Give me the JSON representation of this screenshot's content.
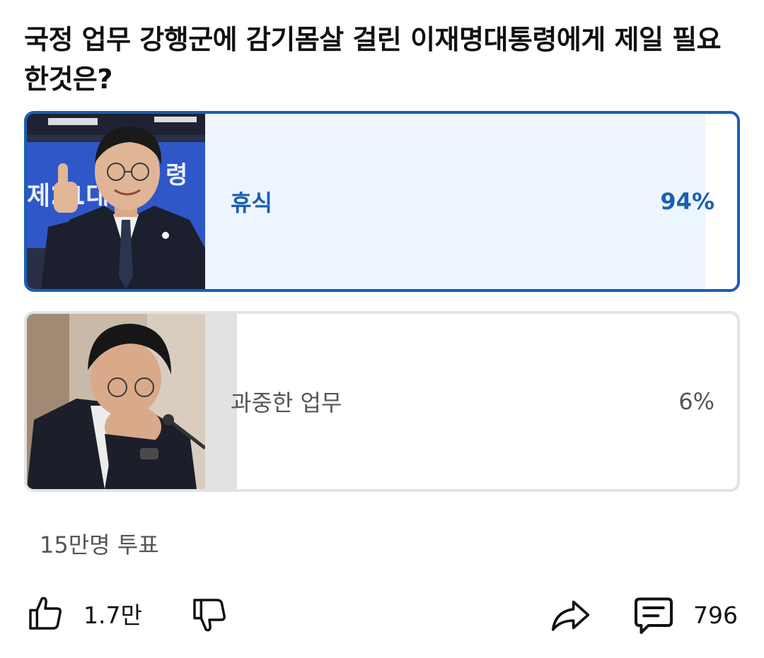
{
  "poll": {
    "question": "국정 업무 강행군에 감기몸살 걸린 이재명대통령에게 제일 필요한것은?",
    "options": [
      {
        "label": "휴식",
        "percent": "94%",
        "fraction": 0.94,
        "selected": true
      },
      {
        "label": "과중한 업무",
        "percent": "6%",
        "fraction": 0.06,
        "selected": false
      }
    ],
    "total_votes": "15만명 투표"
  },
  "actions": {
    "like_count": "1.7만",
    "comment_count": "796"
  },
  "icons": {
    "like": "thumbs-up-icon",
    "dislike": "thumbs-down-icon",
    "share": "share-arrow-icon",
    "comment": "comment-icon"
  },
  "colors": {
    "accent": "#1a5fb4",
    "selected_fill": "#edf5ff",
    "unselected_fill": "#e2e2e2",
    "unselected_border": "#e3e3e3"
  }
}
